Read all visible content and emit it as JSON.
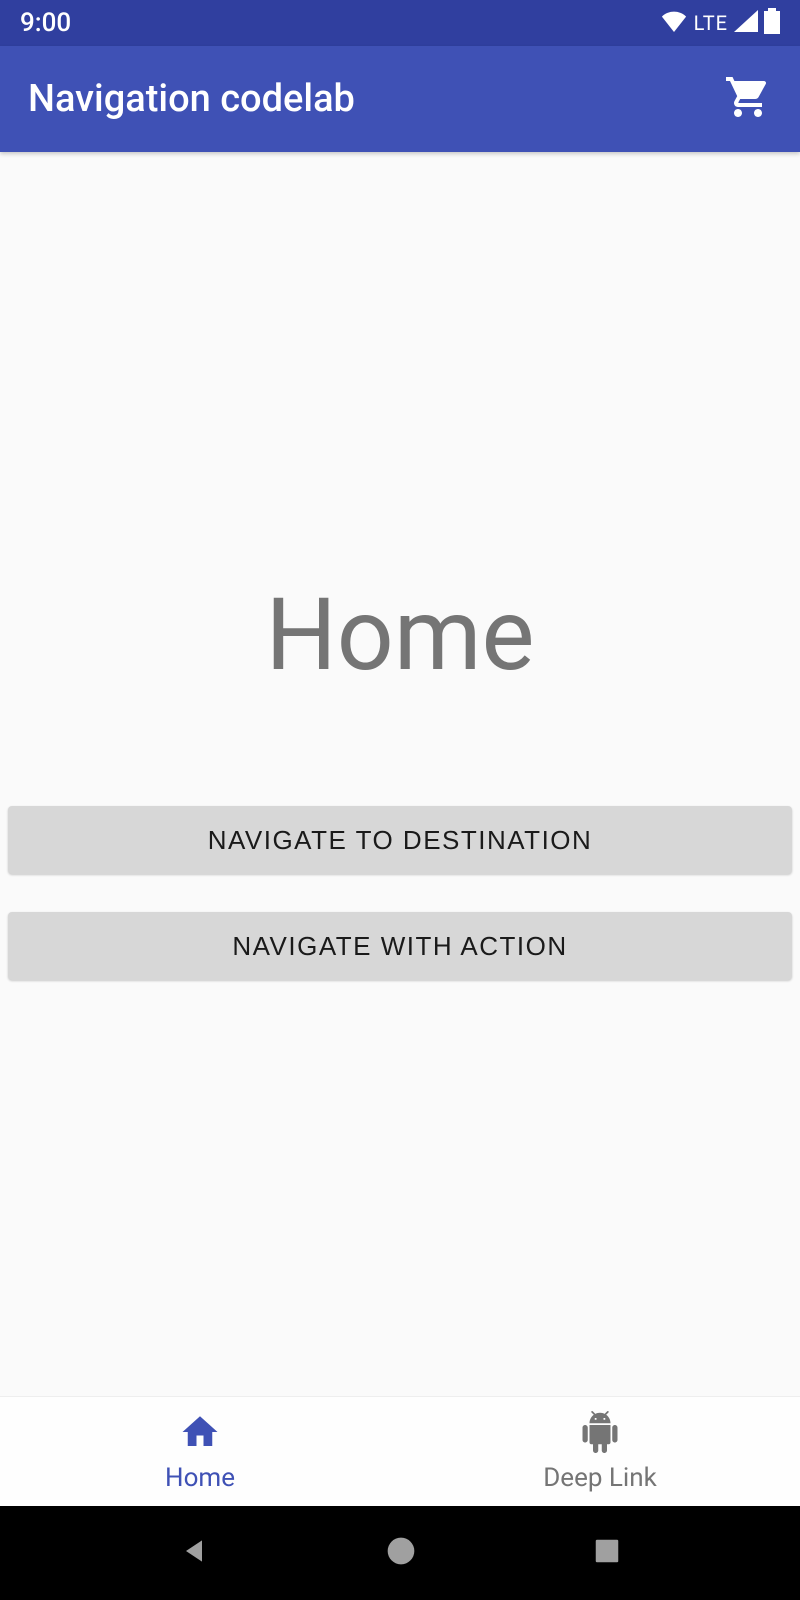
{
  "status_bar": {
    "time": "9:00",
    "network_label": "LTE"
  },
  "app_bar": {
    "title": "Navigation codelab"
  },
  "main": {
    "heading": "Home",
    "buttons": {
      "navigate_destination": "NAVIGATE TO DESTINATION",
      "navigate_action": "NAVIGATE WITH ACTION"
    }
  },
  "bottom_nav": {
    "items": [
      {
        "label": "Home",
        "active": true
      },
      {
        "label": "Deep Link",
        "active": false
      }
    ]
  }
}
